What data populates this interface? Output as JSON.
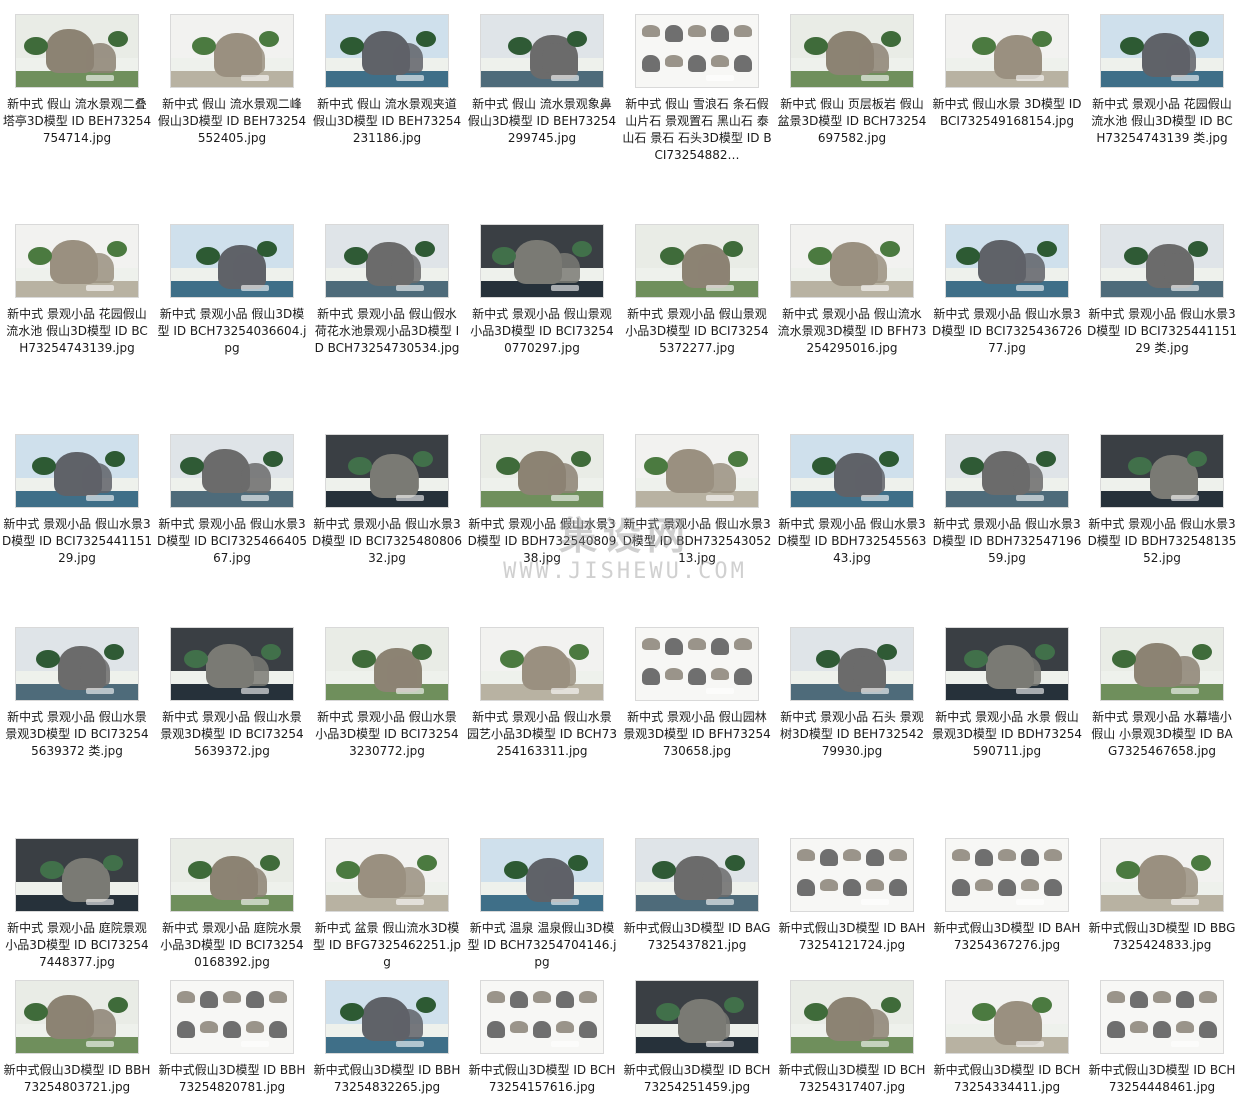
{
  "watermark": {
    "cn": "集设网",
    "en": "WWW.JISHEWU.COM"
  },
  "files": [
    {
      "name": "新中式 假山 流水景观二叠塔亭3D模型 ID BEH73254754714.jpg",
      "icon": "rock-garden-thumbnail"
    },
    {
      "name": "新中式 假山 流水景观二峰假山3D模型 ID BEH73254552405.jpg",
      "icon": "rock-garden-thumbnail"
    },
    {
      "name": "新中式 假山 流水景观夹道假山3D模型 ID BEH73254231186.jpg",
      "icon": "rock-garden-thumbnail"
    },
    {
      "name": "新中式 假山 流水景观象鼻假山3D模型 ID BEH73254299745.jpg",
      "icon": "rock-garden-thumbnail"
    },
    {
      "name": "新中式 假山 雪浪石 条石假山片石 景观置石 黑山石 泰山石 景石 石头3D模型 ID BCI73254882…",
      "icon": "rock-collection-thumbnail"
    },
    {
      "name": "新中式 假山 页层板岩 假山盆景3D模型 ID BCH73254697582.jpg",
      "icon": "rock-garden-thumbnail"
    },
    {
      "name": "新中式 假山水景 3D模型 ID BCI732549168154.jpg",
      "icon": "rock-garden-thumbnail"
    },
    {
      "name": "新中式 景观小品 花园假山流水池 假山3D模型 ID BCH73254743139 类.jpg",
      "icon": "rock-garden-thumbnail"
    },
    {
      "name": "新中式 景观小品 花园假山流水池 假山3D模型 ID BCH73254743139.jpg",
      "icon": "rock-garden-thumbnail"
    },
    {
      "name": "新中式 景观小品 假山3D模型 ID BCH73254036604.jpg",
      "icon": "rock-garden-thumbnail"
    },
    {
      "name": "新中式 景观小品 假山假水荷花水池景观小品3D模型 ID BCH73254730534.jpg",
      "icon": "rock-garden-thumbnail"
    },
    {
      "name": "新中式 景观小品 假山景观小品3D模型 ID BCI732540770297.jpg",
      "icon": "rock-garden-thumbnail"
    },
    {
      "name": "新中式 景观小品 假山景观小品3D模型 ID BCI732545372277.jpg",
      "icon": "rock-garden-thumbnail"
    },
    {
      "name": "新中式 景观小品 假山流水 流水景观3D模型 ID BFH73254295016.jpg",
      "icon": "rock-garden-thumbnail"
    },
    {
      "name": "新中式 景观小品 假山水景3D模型 ID BCI732543672677.jpg",
      "icon": "rock-garden-thumbnail"
    },
    {
      "name": "新中式 景观小品 假山水景3D模型 ID BCI732544115129 类.jpg",
      "icon": "rock-garden-thumbnail"
    },
    {
      "name": "新中式 景观小品 假山水景3D模型 ID BCI732544115129.jpg",
      "icon": "rock-garden-thumbnail"
    },
    {
      "name": "新中式 景观小品 假山水景3D模型 ID BCI732546640567.jpg",
      "icon": "rock-garden-thumbnail"
    },
    {
      "name": "新中式 景观小品 假山水景3D模型 ID BCI732548080632.jpg",
      "icon": "rock-garden-thumbnail"
    },
    {
      "name": "新中式 景观小品 假山水景3D模型 ID BDH73254080938.jpg",
      "icon": "rock-garden-thumbnail"
    },
    {
      "name": "新中式 景观小品 假山水景3D模型 ID BDH73254305213.jpg",
      "icon": "rock-garden-thumbnail"
    },
    {
      "name": "新中式 景观小品 假山水景3D模型 ID BDH73254556343.jpg",
      "icon": "rock-garden-thumbnail"
    },
    {
      "name": "新中式 景观小品 假山水景3D模型 ID BDH73254719659.jpg",
      "icon": "rock-garden-thumbnail"
    },
    {
      "name": "新中式 景观小品 假山水景3D模型 ID BDH73254813552.jpg",
      "icon": "rock-garden-thumbnail"
    },
    {
      "name": "新中式 景观小品 假山水景景观3D模型 ID BCI732545639372 类.jpg",
      "icon": "rock-garden-thumbnail"
    },
    {
      "name": "新中式 景观小品 假山水景景观3D模型 ID BCI732545639372.jpg",
      "icon": "rock-garden-thumbnail"
    },
    {
      "name": "新中式 景观小品 假山水景小品3D模型 ID BCI732543230772.jpg",
      "icon": "rock-garden-thumbnail"
    },
    {
      "name": "新中式 景观小品 假山水景园艺小品3D模型 ID BCH73254163311.jpg",
      "icon": "rock-garden-thumbnail"
    },
    {
      "name": "新中式 景观小品 假山园林景观3D模型 ID BFH73254730658.jpg",
      "icon": "rock-collection-thumbnail"
    },
    {
      "name": "新中式 景观小品 石头 景观树3D模型 ID BEH73254279930.jpg",
      "icon": "rock-garden-thumbnail"
    },
    {
      "name": "新中式 景观小品 水景 假山景观3D模型 ID BDH73254590711.jpg",
      "icon": "rock-garden-thumbnail"
    },
    {
      "name": "新中式 景观小品 水幕墙小假山 小景观3D模型 ID BAG7325467658.jpg",
      "icon": "rock-garden-thumbnail"
    },
    {
      "name": "新中式 景观小品 庭院景观小品3D模型 ID BCI732547448377.jpg",
      "icon": "rock-garden-thumbnail"
    },
    {
      "name": "新中式 景观小品 庭院水景小品3D模型 ID BCI732540168392.jpg",
      "icon": "rock-garden-thumbnail"
    },
    {
      "name": "新中式 盆景 假山流水3D模型 ID BFG7325462251.jpg",
      "icon": "rock-garden-thumbnail"
    },
    {
      "name": "新中式 温泉 温泉假山3D模型 ID BCH73254704146.jpg",
      "icon": "rock-garden-thumbnail"
    },
    {
      "name": "新中式假山3D模型 ID BAG7325437821.jpg",
      "icon": "rock-garden-thumbnail"
    },
    {
      "name": "新中式假山3D模型 ID BAH73254121724.jpg",
      "icon": "rock-collection-thumbnail"
    },
    {
      "name": "新中式假山3D模型 ID BAH73254367276.jpg",
      "icon": "rock-collection-thumbnail"
    },
    {
      "name": "新中式假山3D模型 ID BBG7325424833.jpg",
      "icon": "rock-garden-thumbnail"
    },
    {
      "name": "新中式假山3D模型 ID BBH73254803721.jpg",
      "icon": "rock-garden-thumbnail"
    },
    {
      "name": "新中式假山3D模型 ID BBH73254820781.jpg",
      "icon": "rock-collection-thumbnail"
    },
    {
      "name": "新中式假山3D模型 ID BBH73254832265.jpg",
      "icon": "rock-garden-thumbnail"
    },
    {
      "name": "新中式假山3D模型 ID BCH73254157616.jpg",
      "icon": "rock-collection-thumbnail"
    },
    {
      "name": "新中式假山3D模型 ID BCH73254251459.jpg",
      "icon": "rock-garden-thumbnail"
    },
    {
      "name": "新中式假山3D模型 ID BCH73254317407.jpg",
      "icon": "rock-garden-thumbnail"
    },
    {
      "name": "新中式假山3D模型 ID BCH73254334411.jpg",
      "icon": "rock-garden-thumbnail"
    },
    {
      "name": "新中式假山3D模型 ID BCH73254448461.jpg",
      "icon": "rock-collection-thumbnail"
    }
  ]
}
